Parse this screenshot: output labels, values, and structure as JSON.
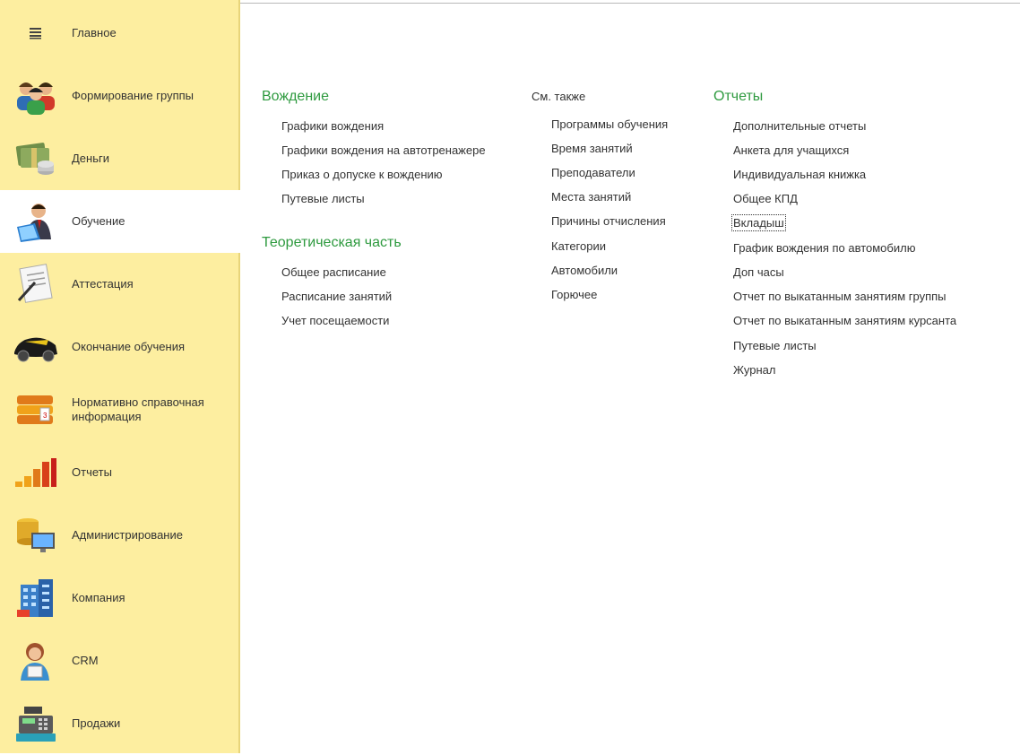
{
  "sidebar": {
    "items": [
      {
        "label": "Главное",
        "icon": "hamburger-menu-icon"
      },
      {
        "label": "Формирование группы",
        "icon": "people-group-icon"
      },
      {
        "label": "Деньги",
        "icon": "money-stack-icon"
      },
      {
        "label": "Обучение",
        "icon": "teacher-laptop-icon"
      },
      {
        "label": "Аттестация",
        "icon": "certificate-pen-icon"
      },
      {
        "label": "Окончание обучения",
        "icon": "sports-car-icon"
      },
      {
        "label": "Нормативно справочная информация",
        "icon": "binders-icon"
      },
      {
        "label": "Отчеты",
        "icon": "bar-chart-icon"
      },
      {
        "label": "Администрирование",
        "icon": "database-computer-icon"
      },
      {
        "label": "Компания",
        "icon": "office-building-icon"
      },
      {
        "label": "CRM",
        "icon": "customer-woman-icon"
      },
      {
        "label": "Продажи",
        "icon": "cash-register-icon"
      }
    ],
    "active_index": 3
  },
  "driving": {
    "title": "Вождение",
    "links": [
      "Графики вождения",
      "Графики вождения на автотренажере",
      "Приказ о допуске к вождению",
      "Путевые листы"
    ]
  },
  "theory": {
    "title": "Теоретическая часть",
    "links": [
      "Общее расписание",
      "Расписание занятий",
      "Учет посещаемости"
    ]
  },
  "see_also": {
    "title": "См. также",
    "links": [
      "Программы обучения",
      "Время занятий",
      "Преподаватели",
      "Места занятий",
      "Причины отчисления",
      "Категории",
      "Автомобили",
      "Горючее"
    ]
  },
  "reports": {
    "title": "Отчеты",
    "links": [
      "Дополнительные отчеты",
      "Анкета для учащихся",
      "Индивидуальная книжка",
      "Общее КПД",
      "Вкладыш",
      "График вождения по автомобилю",
      "Доп часы",
      "Отчет по выкатанным занятиям группы",
      "Отчет по выкатанным занятиям курсанта",
      "Путевые листы",
      "Журнал"
    ]
  },
  "colors": {
    "sidebar_bg": "#fdeea0",
    "section_title": "#2e9a3f",
    "text": "#333333"
  }
}
